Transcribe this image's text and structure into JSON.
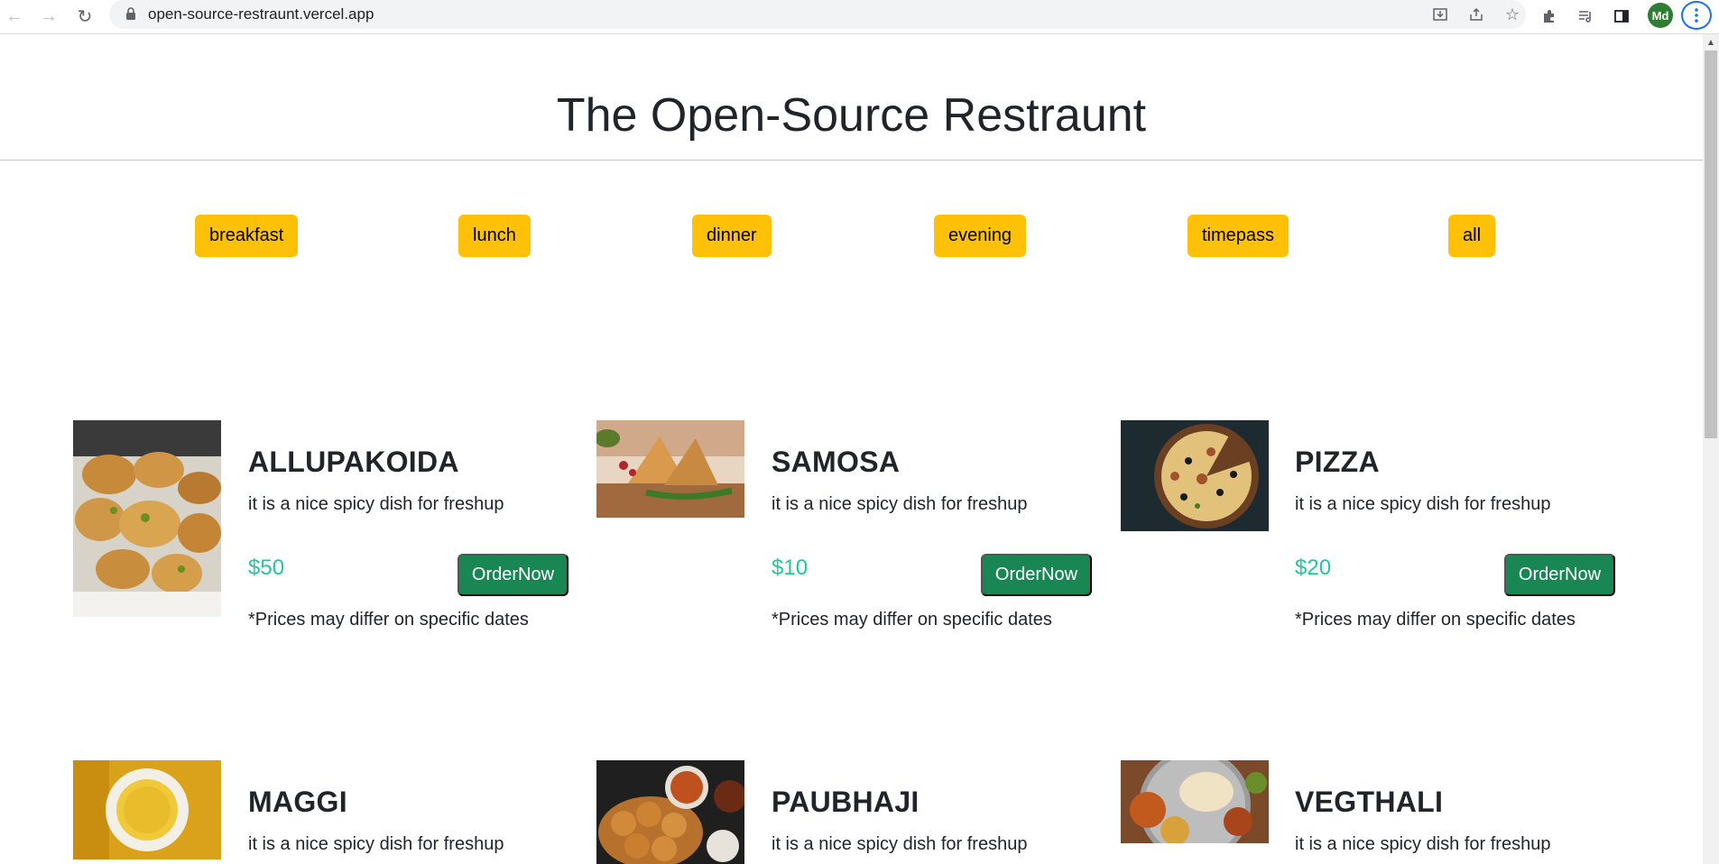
{
  "browser": {
    "url": "open-source-restraunt.vercel.app",
    "profile_initials": "Md"
  },
  "page": {
    "title": "The Open-Source Restraunt",
    "filters": [
      "breakfast",
      "lunch",
      "dinner",
      "evening",
      "timepass",
      "all"
    ],
    "colors": {
      "filter_bg": "#ffc107",
      "order_bg": "#198754",
      "price": "#20c997"
    },
    "dishes": [
      {
        "name": "ALLUPAKOIDA",
        "desc": "it is a nice spicy dish for freshup",
        "price": "$50",
        "button": "OrderNow",
        "note": "*Prices may differ on specific dates",
        "image": "pakora-photo"
      },
      {
        "name": "SAMOSA",
        "desc": "it is a nice spicy dish for freshup",
        "price": "$10",
        "button": "OrderNow",
        "note": "*Prices may differ on specific dates",
        "image": "samosa-photo"
      },
      {
        "name": "PIZZA",
        "desc": "it is a nice spicy dish for freshup",
        "price": "$20",
        "button": "OrderNow",
        "note": "*Prices may differ on specific dates",
        "image": "pizza-photo"
      },
      {
        "name": "MAGGI",
        "desc": "it is a nice spicy dish for freshup",
        "image": "maggi-photo"
      },
      {
        "name": "PAUBHAJI",
        "desc": "it is a nice spicy dish for freshup",
        "image": "paubhaji-photo"
      },
      {
        "name": "VEGTHALI",
        "desc": "it is a nice spicy dish for freshup",
        "image": "thali-photo"
      }
    ]
  }
}
